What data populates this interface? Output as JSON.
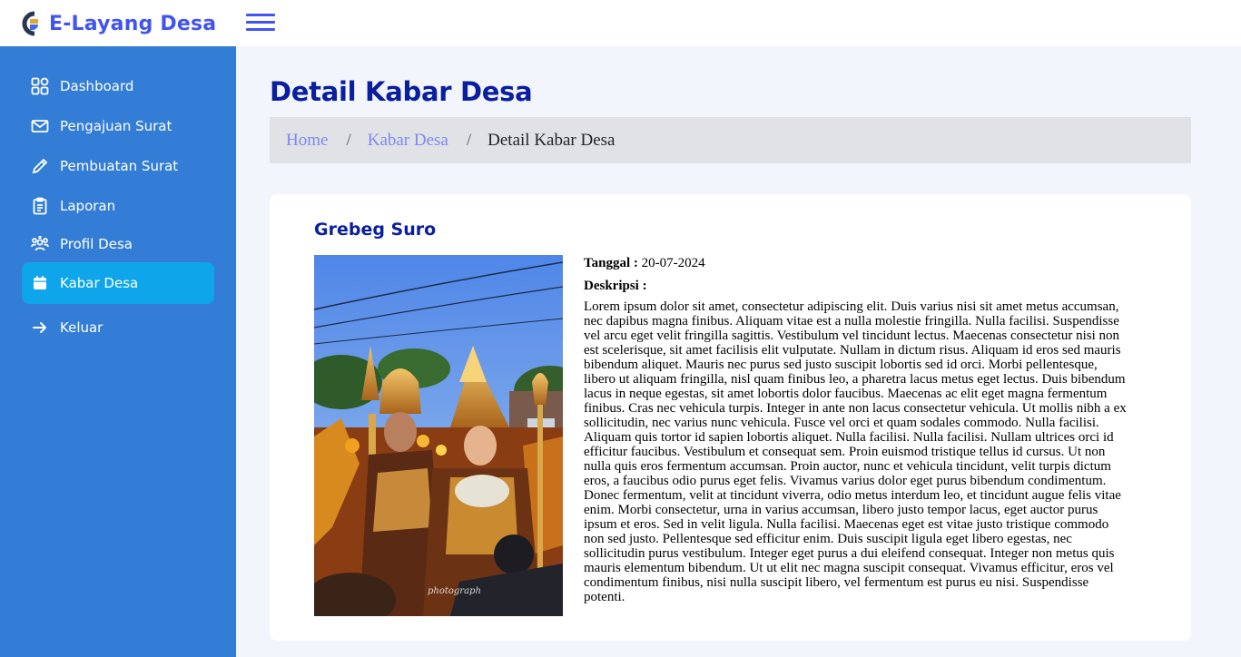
{
  "app": {
    "name": "E-Layang Desa"
  },
  "sidebar": {
    "items": [
      {
        "label": "Dashboard",
        "icon": "grid-icon"
      },
      {
        "label": "Pengajuan Surat",
        "icon": "envelope-icon"
      },
      {
        "label": "Pembuatan Surat",
        "icon": "pencil-icon"
      },
      {
        "label": "Laporan",
        "icon": "clipboard-icon"
      },
      {
        "label": "Profil Desa",
        "icon": "people-icon"
      },
      {
        "label": "Kabar Desa",
        "icon": "calendar-icon",
        "active": true
      },
      {
        "label": "Keluar",
        "icon": "arrow-right-icon"
      }
    ]
  },
  "page": {
    "title": "Detail Kabar Desa",
    "breadcrumb": [
      "Home",
      "Kabar Desa",
      "Detail Kabar Desa"
    ],
    "breadcrumb_separator": "/"
  },
  "news": {
    "title": "Grebeg Suro",
    "date_label": "Tanggal :",
    "date": "20-07-2024",
    "description_label": "Deskripsi :",
    "description": "Lorem ipsum dolor sit amet, consectetur adipiscing elit. Duis varius nisi sit amet metus accumsan, nec dapibus magna finibus. Aliquam vitae est a nulla molestie fringilla. Nulla facilisi. Suspendisse vel arcu eget velit fringilla sagittis. Vestibulum vel tincidunt lectus. Maecenas consectetur nisi non est scelerisque, sit amet facilisis elit vulputate. Nullam in dictum risus. Aliquam id eros sed mauris bibendum aliquet. Mauris nec purus sed justo suscipit lobortis sed id orci. Morbi pellentesque, libero ut aliquam fringilla, nisl quam finibus leo, a pharetra lacus metus eget lectus. Duis bibendum lacus in neque egestas, sit amet lobortis dolor faucibus. Maecenas ac elit eget magna fermentum finibus. Cras nec vehicula turpis. Integer in ante non lacus consectetur vehicula. Ut mollis nibh a ex sollicitudin, nec varius nunc vehicula. Fusce vel orci et quam sodales commodo. Nulla facilisi. Aliquam quis tortor id sapien lobortis aliquet. Nulla facilisi. Nulla facilisi. Nullam ultrices orci id efficitur faucibus. Vestibulum et consequat sem. Proin euismod tristique tellus id cursus. Ut non nulla quis eros fermentum accumsan. Proin auctor, nunc et vehicula tincidunt, velit turpis dictum eros, a faucibus odio purus eget felis. Vivamus varius dolor eget purus bibendum condimentum. Donec fermentum, velit at tincidunt viverra, odio metus interdum leo, et tincidunt augue felis vitae enim. Morbi consectetur, urna in varius accumsan, libero justo tempor lacus, eget auctor purus ipsum et eros. Sed in velit ligula. Nulla facilisi. Maecenas eget est vitae justo tristique commodo non sed justo. Pellentesque sed efficitur enim. Duis suscipit ligula eget libero egestas, nec sollicitudin purus vestibulum. Integer eget purus a dui eleifend consequat. Integer non metus quis mauris elementum bibendum. Ut ut elit nec magna suscipit consequat. Vivamus efficitur, eros vel condimentum finibus, nisi nulla suscipit libero, vel fermentum est purus eu nisi. Suspendisse potenti.",
    "photo_watermark": "photograph"
  },
  "colors": {
    "brand": "#4154f1",
    "sidebar_bg": "#337dd6",
    "sidebar_active": "#0ea5ea",
    "heading": "#0a1f9e",
    "page_bg": "#f2f5fc",
    "breadcrumb_bg": "#e1e2e5"
  }
}
